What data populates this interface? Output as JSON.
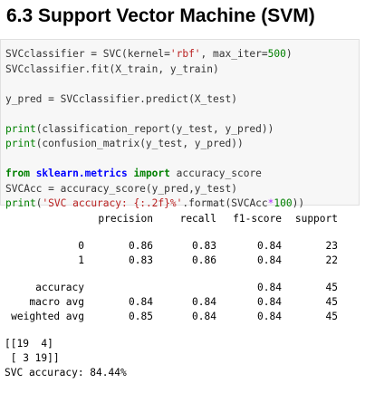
{
  "heading": "6.3 Support Vector Machine (SVM)",
  "code": {
    "l1": {
      "a": "SVCclassifier = SVC(kernel=",
      "b": "'rbf'",
      "c": ", max_iter=",
      "d": "500",
      "e": ")"
    },
    "l2": "SVCclassifier.fit(X_train, y_train)",
    "l3": "y_pred = SVCclassifier.predict(X_test)",
    "l4": {
      "fn": "print",
      "rest": "(classification_report(y_test, y_pred))"
    },
    "l5": {
      "fn": "print",
      "rest": "(confusion_matrix(y_test, y_pred))"
    },
    "l6": {
      "kw1": "from",
      "mod": " sklearn.metrics ",
      "kw2": "import",
      "rest": " accuracy_score"
    },
    "l7": "SVCAcc = accuracy_score(y_pred,y_test)",
    "l8": {
      "fn": "print",
      "p": "(",
      "str": "'SVC accuracy: {:.2f}%'",
      "mid": ".format(SVCAcc",
      "op": "*",
      "num": "100",
      "end": "))"
    }
  },
  "report": {
    "header": [
      "precision",
      "recall",
      "f1-score",
      "support"
    ],
    "rows": [
      {
        "label": "0",
        "precision": "0.86",
        "recall": "0.83",
        "f1": "0.84",
        "support": "23"
      },
      {
        "label": "1",
        "precision": "0.83",
        "recall": "0.86",
        "f1": "0.84",
        "support": "22"
      }
    ],
    "accuracy": {
      "label": "accuracy",
      "f1": "0.84",
      "support": "45"
    },
    "macro": {
      "label": "macro avg",
      "precision": "0.84",
      "recall": "0.84",
      "f1": "0.84",
      "support": "45"
    },
    "weighted": {
      "label": "weighted avg",
      "precision": "0.85",
      "recall": "0.84",
      "f1": "0.84",
      "support": "45"
    }
  },
  "confusion": [
    "[[19  4]",
    " [ 3 19]]"
  ],
  "accuracy_line": "SVC accuracy: 84.44%"
}
